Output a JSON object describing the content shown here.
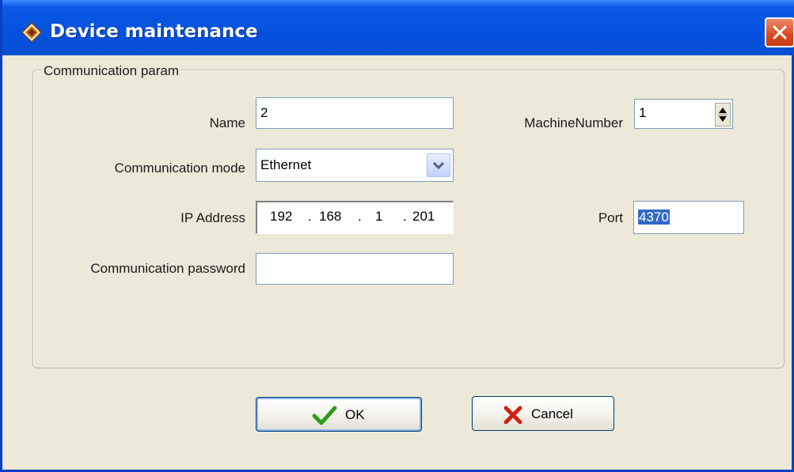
{
  "window": {
    "title": "Device maintenance",
    "close_icon": "close-icon"
  },
  "group": {
    "legend": "Communication param"
  },
  "fields": {
    "name": {
      "label": "Name",
      "value": "2"
    },
    "machine_number": {
      "label": "MachineNumber",
      "value": "1"
    },
    "comm_mode": {
      "label": "Communication mode",
      "value": "Ethernet"
    },
    "ip_address": {
      "label": "IP Address",
      "octets": [
        "192",
        "168",
        "1",
        "201"
      ],
      "separator": "."
    },
    "port": {
      "label": "Port",
      "value": "4370"
    },
    "comm_password": {
      "label": "Communication password",
      "value": ""
    }
  },
  "buttons": {
    "ok": {
      "label": "OK",
      "icon": "checkmark-icon",
      "icon_color": "#2f9a1a"
    },
    "cancel": {
      "label": "Cancel",
      "icon": "x-cross-icon",
      "icon_color": "#d21f0f"
    }
  },
  "colors": {
    "titlebar": "#0654e0",
    "dialog_bg": "#ece9d8",
    "selection": "#316ac5"
  }
}
